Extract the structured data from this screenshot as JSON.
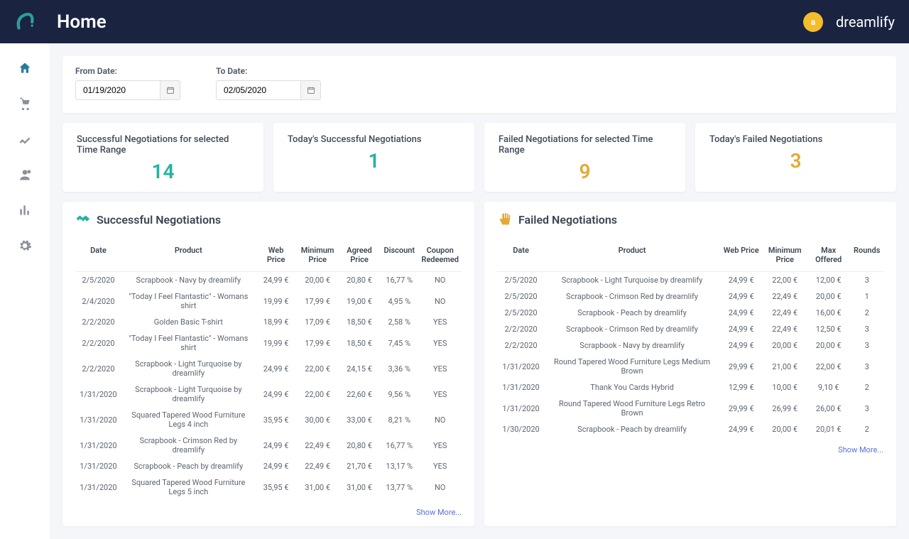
{
  "header": {
    "page_title": "Home",
    "username": "dreamlify",
    "avatar_initial": "a"
  },
  "sidebar_icons": [
    "home",
    "cart",
    "chart",
    "users",
    "bar",
    "gear"
  ],
  "filters": {
    "from_label": "From Date:",
    "to_label": "To Date:",
    "from_value": "01/19/2020",
    "to_value": "02/05/2020"
  },
  "stats": {
    "success_range": {
      "title": "Successful Negotiations for selected Time Range",
      "value": "14"
    },
    "success_today": {
      "title": "Today's Successful Negotiations",
      "value": "1"
    },
    "failed_range": {
      "title": "Failed Negotiations for selected Time Range",
      "value": "9"
    },
    "failed_today": {
      "title": "Today's Failed Negotiations",
      "value": "3"
    }
  },
  "success_table": {
    "title": "Successful Negotiations",
    "columns": [
      "Date",
      "Product",
      "Web Price",
      "Minimum Price",
      "Agreed Price",
      "Discount",
      "Coupon Redeemed"
    ],
    "rows": [
      [
        "2/5/2020",
        "Scrapbook - Navy by dreamlify",
        "24,99 €",
        "20,00 €",
        "20,80 €",
        "16,77 %",
        "NO"
      ],
      [
        "2/4/2020",
        "\"Today I Feel Flantastic\" - Womans shirt",
        "19,99 €",
        "17,99 €",
        "19,00 €",
        "4,95 %",
        "NO"
      ],
      [
        "2/2/2020",
        "Golden Basic T-shirt",
        "18,99 €",
        "17,09 €",
        "18,50 €",
        "2,58 %",
        "YES"
      ],
      [
        "2/2/2020",
        "\"Today I Feel Flantastic\" - Womans shirt",
        "19,99 €",
        "17,99 €",
        "18,50 €",
        "7,45 %",
        "YES"
      ],
      [
        "2/2/2020",
        "Scrapbook - Light Turquoise by dreamlify",
        "24,99 €",
        "22,00 €",
        "24,15 €",
        "3,36 %",
        "YES"
      ],
      [
        "1/31/2020",
        "Scrapbook - Light Turquoise by dreamlify",
        "24,99 €",
        "22,00 €",
        "22,60 €",
        "9,56 %",
        "YES"
      ],
      [
        "1/31/2020",
        "Squared Tapered Wood Furniture Legs 4 inch",
        "35,95 €",
        "30,00 €",
        "33,00 €",
        "8,21 %",
        "NO"
      ],
      [
        "1/31/2020",
        "Scrapbook - Crimson Red by dreamlify",
        "24,99 €",
        "22,49 €",
        "20,80 €",
        "16,77 %",
        "YES"
      ],
      [
        "1/31/2020",
        "Scrapbook - Peach by dreamlify",
        "24,99 €",
        "22,49 €",
        "21,70 €",
        "13,17 %",
        "YES"
      ],
      [
        "1/31/2020",
        "Squared Tapered Wood Furniture Legs 5 inch",
        "35,95 €",
        "31,00 €",
        "31,00 €",
        "13,77 %",
        "NO"
      ]
    ],
    "show_more": "Show More..."
  },
  "failed_table": {
    "title": "Failed Negotiations",
    "columns": [
      "Date",
      "Product",
      "Web Price",
      "Minimum Price",
      "Max Offered",
      "Rounds"
    ],
    "rows": [
      [
        "2/5/2020",
        "Scrapbook - Light Turquoise by dreamlify",
        "24,99 €",
        "22,00 €",
        "12,00 €",
        "3"
      ],
      [
        "2/5/2020",
        "Scrapbook - Crimson Red by dreamlify",
        "24,99 €",
        "22,49 €",
        "20,00 €",
        "1"
      ],
      [
        "2/5/2020",
        "Scrapbook - Peach by dreamlify",
        "24,99 €",
        "22,49 €",
        "16,00 €",
        "2"
      ],
      [
        "2/2/2020",
        "Scrapbook - Crimson Red by dreamlify",
        "24,99 €",
        "22,49 €",
        "12,50 €",
        "3"
      ],
      [
        "2/2/2020",
        "Scrapbook - Navy by dreamlify",
        "24,99 €",
        "20,00 €",
        "20,00 €",
        "3"
      ],
      [
        "1/31/2020",
        "Round Tapered Wood Furniture Legs Medium Brown",
        "29,99 €",
        "21,00 €",
        "22,00 €",
        "3"
      ],
      [
        "1/31/2020",
        "Thank You Cards Hybrid",
        "12,99 €",
        "10,00 €",
        "9,10 €",
        "2"
      ],
      [
        "1/31/2020",
        "Round Tapered Wood Furniture Legs Retro Brown",
        "29,99 €",
        "26,99 €",
        "26,00 €",
        "3"
      ],
      [
        "1/30/2020",
        "Scrapbook - Peach by dreamlify",
        "24,99 €",
        "20,00 €",
        "20,01 €",
        "2"
      ]
    ],
    "show_more": "Show More..."
  }
}
